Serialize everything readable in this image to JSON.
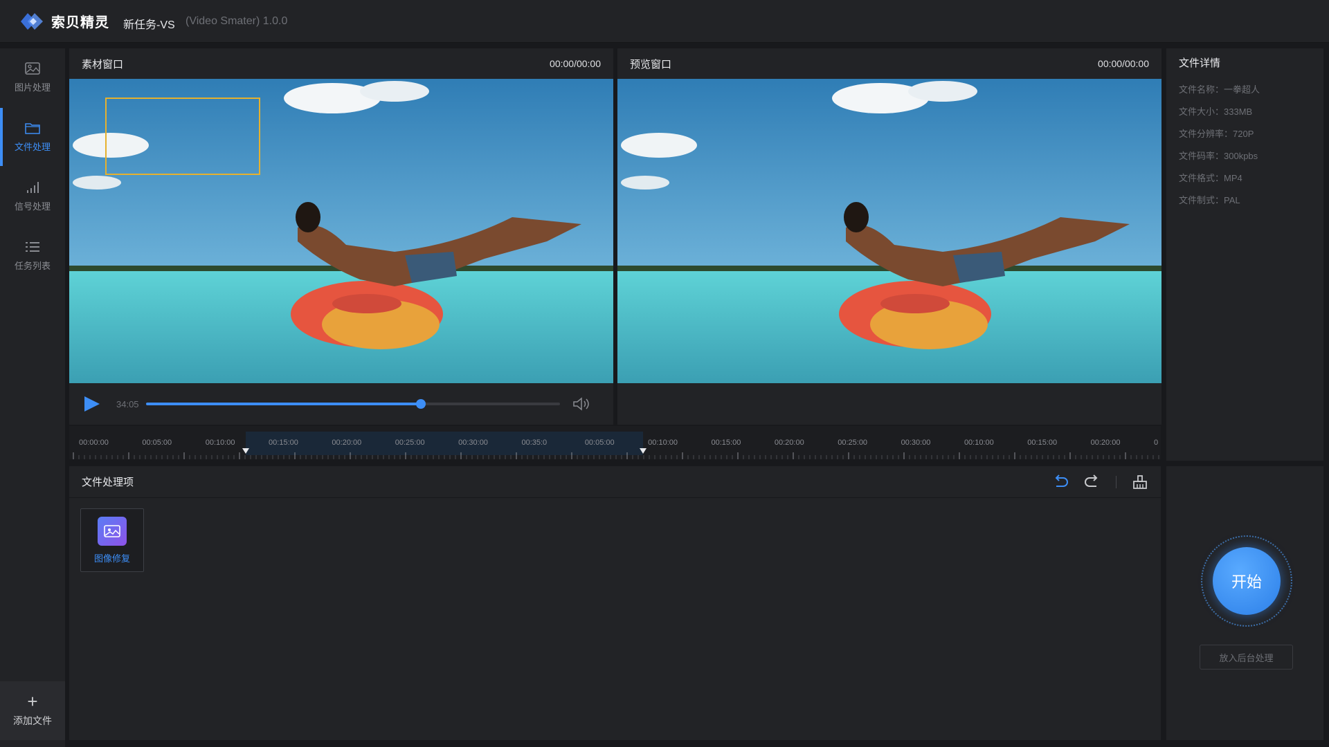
{
  "app": {
    "brand": "索贝精灵",
    "task_title": "新任务-VS",
    "version_text": "(Video Smater) 1.0.0"
  },
  "sidebar": {
    "items": [
      {
        "label": "图片处理",
        "icon": "image-icon",
        "active": false
      },
      {
        "label": "文件处理",
        "icon": "folder-icon",
        "active": true
      },
      {
        "label": "信号处理",
        "icon": "signal-bars-icon",
        "active": false
      },
      {
        "label": "任务列表",
        "icon": "list-icon",
        "active": false
      }
    ],
    "add_file_label": "添加文件"
  },
  "source_window": {
    "title": "素材窗口",
    "time": "00:00/00:00"
  },
  "preview_window": {
    "title": "预览窗口",
    "time": "00:00/00:00"
  },
  "player": {
    "current_time": "34:05",
    "progress": 0.665
  },
  "details": {
    "title": "文件详情",
    "rows": [
      "文件名称：一拳超人",
      "文件大小：333MB",
      "文件分辨率：720P",
      "文件码率：300kpbs",
      "文件格式：MP4",
      "文件制式：PAL"
    ]
  },
  "timeline": {
    "labels": [
      "00:00:00",
      "00:05:00",
      "00:10:00",
      "00:15:00",
      "00:20:00",
      "00:25:00",
      "00:30:00",
      "00:35:0",
      "00:05:00",
      "00:10:00",
      "00:15:00",
      "00:20:00",
      "00:25:00",
      "00:30:00",
      "00:10:00",
      "00:15:00",
      "00:20:00",
      "0"
    ]
  },
  "processing": {
    "title": "文件处理项",
    "items": [
      {
        "label": "图像修复",
        "icon": "image-repair-icon"
      }
    ]
  },
  "start": {
    "label": "开始",
    "background_label": "放入后台处理"
  },
  "colors": {
    "accent": "#3d8ef6",
    "selection": "#e6b12e"
  }
}
